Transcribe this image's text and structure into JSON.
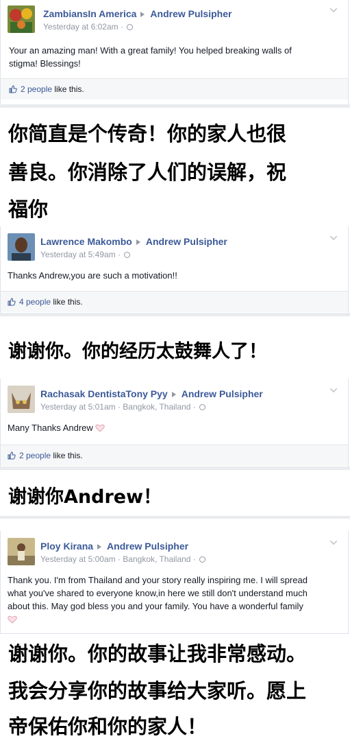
{
  "colors": {
    "link": "#3b5998",
    "meta": "#9197a3",
    "text": "#141823"
  },
  "posts": [
    {
      "author": "ZambiansIn America",
      "target": "Andrew Pulsipher",
      "meta": "Yesterday at 6:02am ·",
      "text_line1": "Your an amazing man! With a great family! You helped breaking walls of",
      "text_line2": "stigma! Blessings!",
      "likes_count": "2 people",
      "likes_suffix": " like this."
    },
    {
      "author": "Lawrence Makombo",
      "target": "Andrew Pulsipher",
      "meta": "Yesterday at 5:49am ·",
      "text_line1": "Thanks Andrew,you are such a motivation!!",
      "likes_count": "4 people",
      "likes_suffix": " like this."
    },
    {
      "author": "Rachasak DentistaTony Pyy",
      "target": "Andrew Pulsipher",
      "meta": "Yesterday at 5:01am · Bangkok, Thailand ·",
      "text_line1": "Many Thanks Andrew",
      "likes_count": "2 people",
      "likes_suffix": " like this."
    },
    {
      "author": "Ploy Kirana",
      "target": "Andrew Pulsipher",
      "meta": "Yesterday at 5:00am · Bangkok, Thailand ·",
      "text_line1": "Thank you. I'm from Thailand and your story really inspiring me. I will spread",
      "text_line2": "what you've shared to everyone know,in here we still don't understand much",
      "text_line3": "about this. May god bless you and your family. You have a wonderful family"
    }
  ],
  "translations": [
    {
      "line1": "你简直是个传奇！你的家人也很",
      "line2": "善良。你消除了人们的误解，祝",
      "line3": "福你"
    },
    {
      "line1": "谢谢你。你的经历太鼓舞人了！"
    },
    {
      "line1": "谢谢你Andrew！"
    },
    {
      "line1": "谢谢你。你的故事让我非常感动。",
      "line2": "我会分享你的故事给大家听。愿上",
      "line3": "帝保佑你和你的家人！"
    }
  ]
}
